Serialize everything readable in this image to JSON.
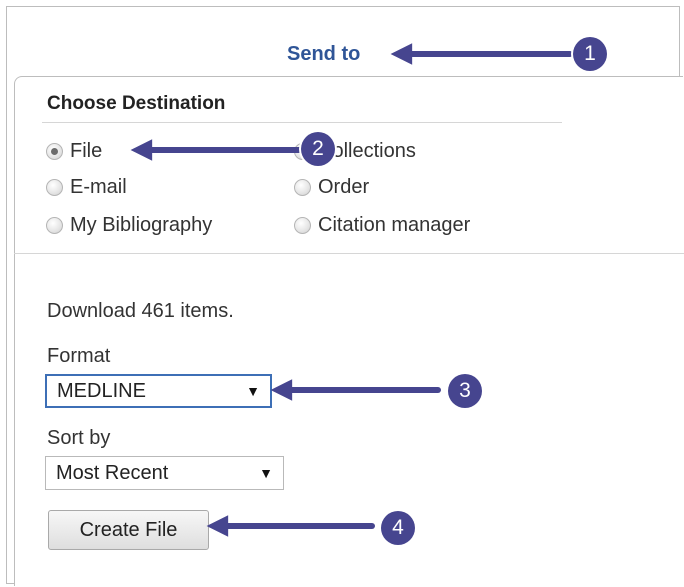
{
  "header": {
    "send_to": "Send to"
  },
  "destination": {
    "title": "Choose Destination",
    "options": [
      {
        "label": "File",
        "checked": true
      },
      {
        "label": "Collections",
        "checked": false
      },
      {
        "label": "E-mail",
        "checked": false
      },
      {
        "label": "Order",
        "checked": false
      },
      {
        "label": "My Bibliography",
        "checked": false
      },
      {
        "label": "Citation manager",
        "checked": false
      }
    ]
  },
  "download": {
    "summary": "Download 461 items.",
    "format_label": "Format",
    "format_value": "MEDLINE",
    "sort_label": "Sort by",
    "sort_value": "Most Recent",
    "create_button": "Create File"
  },
  "callouts": [
    "1",
    "2",
    "3",
    "4"
  ],
  "colors": {
    "accent": "#46458f",
    "link": "#2f5597"
  },
  "icons": {
    "dropdown": "triangle-down"
  }
}
